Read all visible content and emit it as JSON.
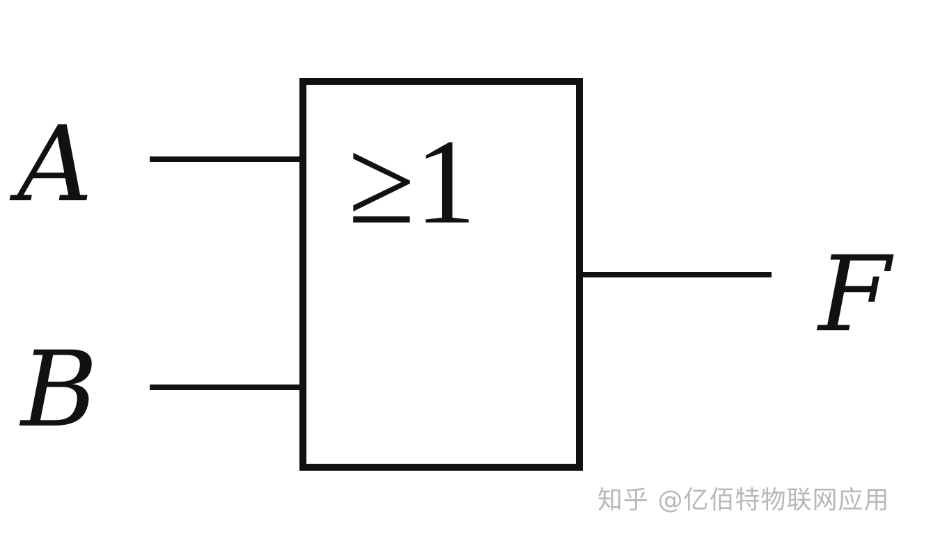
{
  "diagram": {
    "gate_type": "OR",
    "symbol": "≥1",
    "inputs": [
      "A",
      "B"
    ],
    "output": "F"
  },
  "watermark": "知乎 @亿佰特物联网应用"
}
